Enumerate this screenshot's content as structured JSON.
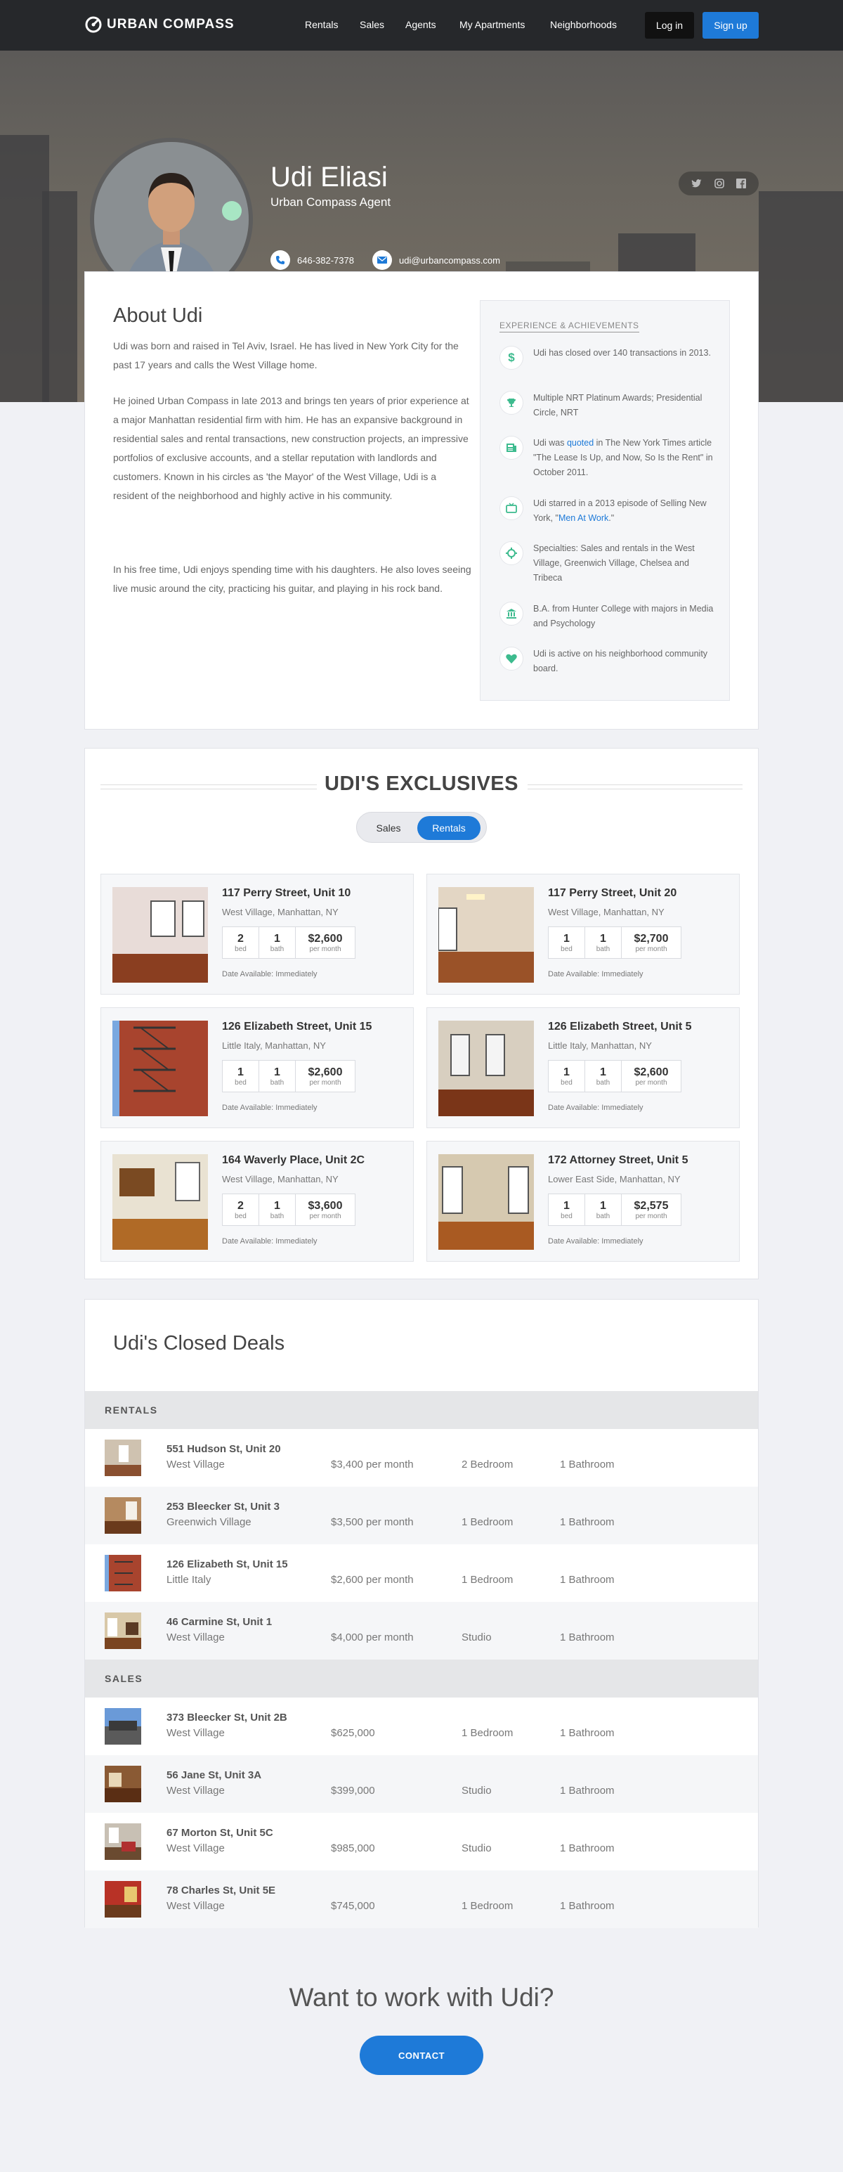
{
  "nav": {
    "brand": "URBAN COMPASS",
    "links": [
      "Rentals",
      "Sales",
      "Agents",
      "My Apartments",
      "Neighborhoods"
    ],
    "login": "Log in",
    "signup": "Sign up"
  },
  "agent": {
    "name": "Udi Eliasi",
    "title": "Urban Compass Agent",
    "phone": "646-382-7378",
    "email": "udi@urbancompass.com"
  },
  "about": {
    "title": "About Udi",
    "paragraphs": [
      "Udi was born and raised in Tel Aviv, Israel. He has lived in New York City for the past 17 years and calls the West Village home.",
      "He joined Urban Compass in late 2013 and brings ten years of prior experience at a major Manhattan residential firm with him. He has an expansive background in residential sales and rental transactions, new construction projects, an impressive portfolios of exclusive accounts, and a stellar reputation with landlords and customers. Known in his circles as 'the Mayor' of the West Village, Udi is a resident of the neighborhood and highly active in his community.",
      "In his free time, Udi enjoys spending time with his daughters. He also loves seeing live music around the city, practicing his guitar, and playing in his rock band."
    ]
  },
  "experience": {
    "title": "EXPERIENCE & ACHIEVEMENTS",
    "items": [
      {
        "icon": "dollar-icon",
        "text": "Udi has closed over 140 transactions in 2013."
      },
      {
        "icon": "trophy-icon",
        "text": "Multiple NRT Platinum Awards; Presidential Circle, NRT"
      },
      {
        "icon": "newspaper-icon",
        "pre": "Udi was ",
        "link": "quoted",
        "post": " in The New York Times article \"The Lease Is Up, and Now, So Is the Rent\" in October 2011."
      },
      {
        "icon": "tv-icon",
        "pre": "Udi starred in a 2013 episode of Selling New York, \"",
        "link": "Men At Work",
        "post": ".\""
      },
      {
        "icon": "target-icon",
        "text": "Specialties: Sales and rentals in the West Village, Greenwich Village, Chelsea and Tribeca"
      },
      {
        "icon": "bank-icon",
        "text": "B.A. from Hunter College with majors in Media and Psychology"
      },
      {
        "icon": "heart-icon",
        "text": "Udi is active on his neighborhood community board."
      }
    ]
  },
  "exclusives": {
    "title": "UDI'S EXCLUSIVES",
    "toggle": {
      "sales": "Sales",
      "rentals": "Rentals"
    },
    "listings": [
      {
        "address": "117 Perry Street, Unit 10",
        "hood": "West Village, Manhattan, NY",
        "bed": "2",
        "bath": "1",
        "price": "$2,600",
        "avail": "Date Available: Immediately"
      },
      {
        "address": "117 Perry Street, Unit 20",
        "hood": "West Village, Manhattan, NY",
        "bed": "1",
        "bath": "1",
        "price": "$2,700",
        "avail": "Date Available: Immediately"
      },
      {
        "address": "126 Elizabeth Street, Unit 15",
        "hood": "Little Italy, Manhattan, NY",
        "bed": "1",
        "bath": "1",
        "price": "$2,600",
        "avail": "Date Available: Immediately"
      },
      {
        "address": "126 Elizabeth Street, Unit 5",
        "hood": "Little Italy, Manhattan, NY",
        "bed": "1",
        "bath": "1",
        "price": "$2,600",
        "avail": "Date Available: Immediately"
      },
      {
        "address": "164 Waverly Place, Unit 2C",
        "hood": "West Village, Manhattan, NY",
        "bed": "2",
        "bath": "1",
        "price": "$3,600",
        "avail": "Date Available: Immediately"
      },
      {
        "address": "172 Attorney Street, Unit 5",
        "hood": "Lower East Side, Manhattan, NY",
        "bed": "1",
        "bath": "1",
        "price": "$2,575",
        "avail": "Date Available: Immediately"
      }
    ],
    "labels": {
      "bed": "bed",
      "bath": "bath",
      "per_month": "per month"
    }
  },
  "closed": {
    "title": "Udi's Closed Deals",
    "rentals_label": "RENTALS",
    "sales_label": "SALES",
    "rentals": [
      {
        "address": "551 Hudson St, Unit 20",
        "hood": "West Village",
        "price": "$3,400 per month",
        "beds": "2 Bedroom",
        "baths": "1 Bathroom"
      },
      {
        "address": "253 Bleecker St, Unit 3",
        "hood": "Greenwich Village",
        "price": "$3,500 per month",
        "beds": "1 Bedroom",
        "baths": "1 Bathroom"
      },
      {
        "address": "126 Elizabeth St, Unit 15",
        "hood": "Little Italy",
        "price": "$2,600 per month",
        "beds": "1 Bedroom",
        "baths": "1 Bathroom"
      },
      {
        "address": "46 Carmine St, Unit 1",
        "hood": "West Village",
        "price": "$4,000 per month",
        "beds": "Studio",
        "baths": "1 Bathroom"
      }
    ],
    "sales": [
      {
        "address": "373 Bleecker St, Unit 2B",
        "hood": "West Village",
        "price": "$625,000",
        "beds": "1 Bedroom",
        "baths": "1 Bathroom"
      },
      {
        "address": "56 Jane St, Unit 3A",
        "hood": "West Village",
        "price": "$399,000",
        "beds": "Studio",
        "baths": "1 Bathroom"
      },
      {
        "address": "67 Morton St, Unit 5C",
        "hood": "West Village",
        "price": "$985,000",
        "beds": "Studio",
        "baths": "1 Bathroom"
      },
      {
        "address": "78 Charles St, Unit 5E",
        "hood": "West Village",
        "price": "$745,000",
        "beds": "1 Bedroom",
        "baths": "1 Bathroom"
      }
    ]
  },
  "cta": {
    "title": "Want to work with Udi?",
    "button": "CONTACT"
  }
}
